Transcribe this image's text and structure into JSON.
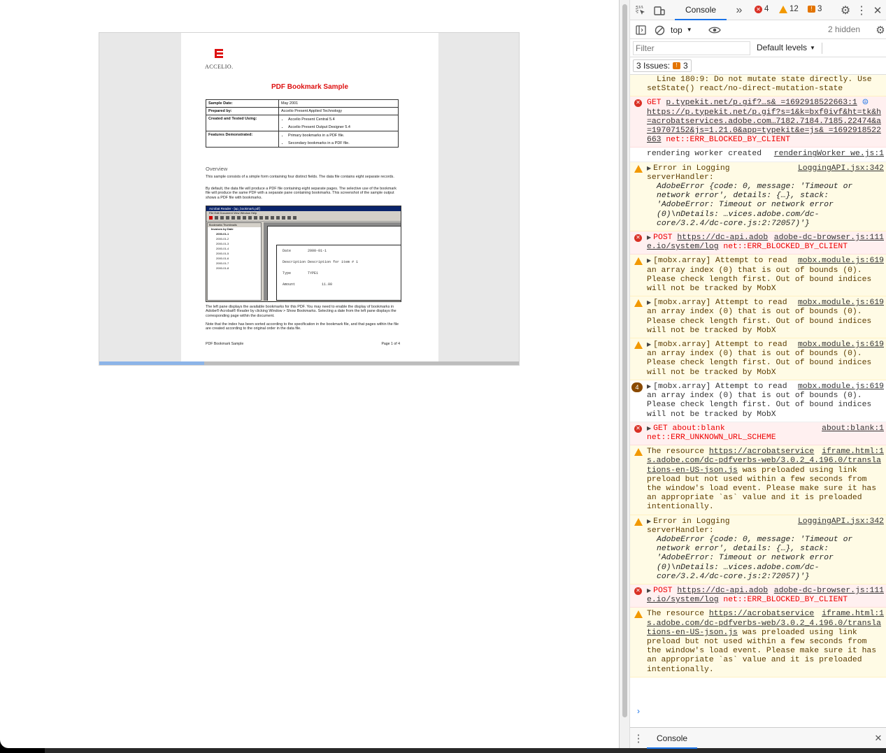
{
  "pdf": {
    "logo_text": "ACCELIO.",
    "title": "PDF Bookmark Sample",
    "meta_rows": [
      {
        "key": "Sample Date:",
        "value": "May 2001"
      },
      {
        "key": "Prepared by:",
        "value": "Accelio Present Applied Technology"
      },
      {
        "key": "Created and Tested Using:",
        "items": [
          "Accelio Present Central 5.4",
          "Accelio Present Output Designer 5.4"
        ]
      },
      {
        "key": "Features Demonstrated:",
        "items": [
          "Primary bookmarks in a PDF file.",
          "Secondary bookmarks in a PDF file."
        ]
      }
    ],
    "overview_heading": "Overview",
    "para1": "This sample consists of a simple form containing four distinct fields. The data file contains eight separate records.",
    "para2": "By default, the data file will produce a PDF file containing eight separate pages. The selective use of the bookmark file will produce the same PDF with a separate pane containing bookmarks. This screenshot of the sample output shows a PDF file with bookmarks.",
    "shot": {
      "window_title": "Acrobat Reader - [ap_bookmark.pdf]",
      "menu": "File   Edit   Document   View   Window   Help",
      "tabs": "Bookmarks   Thumbnails",
      "root": "Invoices by Date",
      "bookmarks": [
        "2000-01-1",
        "2000-01-2",
        "2000-01-3",
        "2000-01-4",
        "2000-01-5",
        "2000-01-6",
        "2000-01-7",
        "2000-01-8"
      ],
      "form": [
        {
          "label": "Date",
          "value": "2000-01-1"
        },
        {
          "label": "Description",
          "value": "Description for item # 1"
        },
        {
          "label": "Type",
          "value": "TYPE1"
        },
        {
          "label": "Amount",
          "value": "11.00"
        }
      ]
    },
    "para3": "The left pane displays the available bookmarks for this PDF. You may need to enable the display of bookmarks in Adobe® Acrobat® Reader by clicking Window > Show Bookmarks. Selecting a date from the left pane displays the corresponding page within the document.",
    "para4": "Note that the index has been sorted according to the specification in the bookmark file, and that pages within the file are created according to the original order in the data file.",
    "footer_left": "PDF Bookmark Sample",
    "footer_right": "Page 1 of 4",
    "progress": 0.25
  },
  "devtools": {
    "tab_console": "Console",
    "more_tabs": "»",
    "errors": "4",
    "warnings": "12",
    "issues_count": "3",
    "context": "top",
    "hidden": "2 hidden",
    "filter_placeholder": "Filter",
    "levels": "Default levels",
    "issues_button": "3 Issues:",
    "issues_button_count": "3",
    "drawer_tab": "Console",
    "colors": {
      "accent": "#1a73e8",
      "error": "#d93025",
      "warning": "#f29900"
    }
  },
  "log": {
    "m0": "Line 180:9:  Do not mutate state directly. Use setState()  react/no-direct-mutation-state",
    "m1_method": "GET ",
    "m1_url": "p.typekit.net/p.gif?…s& =1692918522663:1",
    "m1_rest": "https://p.typekit.net/p.gif?s=1&k=bxf0ivf&ht=tk&h=acrobatservices.adobe.com…7182.7184.7185.22474&a=19707152&js=1.21.0&app=typekit&e=js& =1692918522663",
    "m1_err": " net::ERR_BLOCKED_BY_CLIENT",
    "m2_text": "rendering worker created",
    "m2_src": "renderingWorker we.js:1",
    "m3_head": "Error in Logging serverHandler:",
    "m3_src": "LoggingAPI.jsx:342",
    "m3_obj1": "AdobeError {code: 0, message: 'Timeout or network error', details: {…}, stack: 'AdobeError: Timeout or network error (0)\\nDetails: …vices.adobe.com/dc-core/3.2.4/dc-core.js:2:72057)'}",
    "m4_method": "POST ",
    "m4_url": "https://dc-api.adobe.io/system/log",
    "m4_src": "adobe-dc-browser.js:111",
    "m4_err": " net::ERR_BLOCKED_BY_CLIENT",
    "mobx_text": "[mobx.array] Attempt to read an array index (0) that is out of bounds (0). Please check length first. Out of bound indices will not be tracked by MobX",
    "mobx_src": "mobx.module.js:619",
    "mobx_count": "4",
    "m9_text": "GET about:blank",
    "m9_src": "about:blank:1",
    "m9_err": "net::ERR_UNKNOWN_URL_SCHEME",
    "res_head": "The resource ",
    "res_url": "https://acrobatservices.adobe.com/dc-pdfverbs-web/3.0.2_4.196.0/translations-en-US-json.js",
    "res_src": "iframe.html:1",
    "res_tail": " was preloaded using link preload but not used within a few seconds from the window's load event. Please make sure it has an appropriate `as` value and it is preloaded intentionally."
  }
}
